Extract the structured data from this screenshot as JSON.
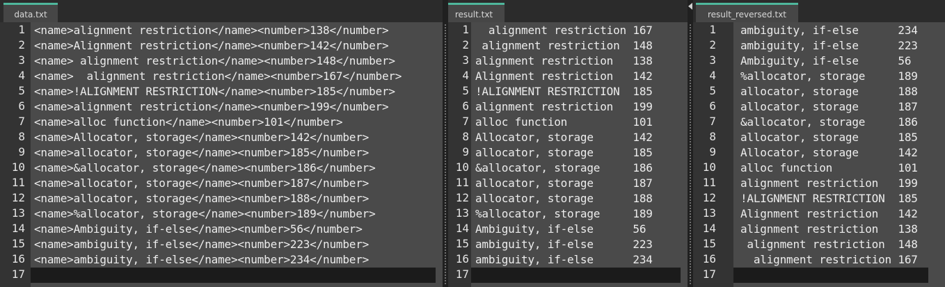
{
  "panes": [
    {
      "tab": "data.txt",
      "lines": [
        "<name>alignment restriction</name><number>138</number>",
        "<name>Alignment restriction</name><number>142</number>",
        "<name> alignment restriction</name><number>148</number>",
        "<name>  alignment restriction</name><number>167</number>",
        "<name>!ALIGNMENT RESTRICTION</name><number>185</number>",
        "<name>alignment restriction</name><number>199</number>",
        "<name>alloc function</name><number>101</number>",
        "<name>Allocator, storage</name><number>142</number>",
        "<name>allocator, storage</name><number>185</number>",
        "<name>&allocator, storage</name><number>186</number>",
        "<name>allocator, storage</name><number>187</number>",
        "<name>allocator, storage</name><number>188</number>",
        "<name>%allocator, storage</name><number>189</number>",
        "<name>Ambiguity, if-else</name><number>56</number>",
        "<name>ambiguity, if-else</name><number>223</number>",
        "<name>ambiguity, if-else</name><number>234</number>",
        ""
      ]
    },
    {
      "tab": "result.txt",
      "lines": [
        "  alignment restriction 167",
        " alignment restriction  148",
        "alignment restriction   138",
        "Alignment restriction   142",
        "!ALIGNMENT RESTRICTION  185",
        "alignment restriction   199",
        "alloc function          101",
        "Allocator, storage      142",
        "allocator, storage      185",
        "&allocator, storage     186",
        "allocator, storage      187",
        "allocator, storage      188",
        "%allocator, storage     189",
        "Ambiguity, if-else      56",
        "ambiguity, if-else      223",
        "ambiguity, if-else      234",
        ""
      ]
    },
    {
      "tab": "result_reversed.txt",
      "lines": [
        "ambiguity, if-else      234",
        "ambiguity, if-else      223",
        "Ambiguity, if-else      56",
        "%allocator, storage     189",
        "allocator, storage      188",
        "allocator, storage      187",
        "&allocator, storage     186",
        "allocator, storage      185",
        "Allocator, storage      142",
        "alloc function          101",
        "alignment restriction   199",
        "!ALIGNMENT RESTRICTION  185",
        "Alignment restriction   142",
        "alignment restriction   138",
        " alignment restriction  148",
        "  alignment restriction 167",
        ""
      ]
    }
  ],
  "line_numbers": [
    "1",
    "2",
    "3",
    "4",
    "5",
    "6",
    "7",
    "8",
    "9",
    "10",
    "11",
    "12",
    "13",
    "14",
    "15",
    "16",
    "17"
  ],
  "colors": {
    "tab_accent": "#4fb79c",
    "editor_bg": "#4a4a4a",
    "current_line_bg": "#1b1b1b",
    "text": "#ececec"
  }
}
